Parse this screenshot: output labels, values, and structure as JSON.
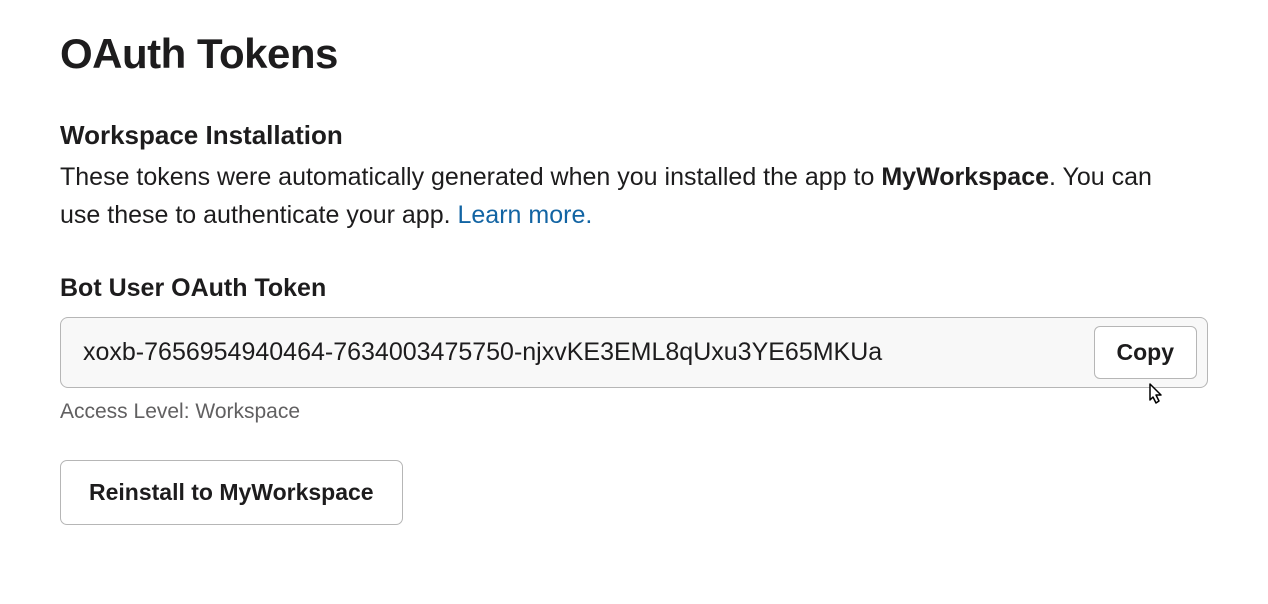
{
  "page": {
    "title": "OAuth Tokens"
  },
  "workspace_installation": {
    "heading": "Workspace Installation",
    "description_prefix": "These tokens were automatically generated when you installed the app to ",
    "workspace_name": "MyWorkspace",
    "description_suffix": ". You can use these to authenticate your app. ",
    "learn_more_label": "Learn more."
  },
  "token": {
    "label": "Bot User OAuth Token",
    "value": "xoxb-7656954940464-7634003475750-njxvKE3EML8qUxu3YE65MKUa",
    "copy_label": "Copy",
    "access_level": "Access Level: Workspace"
  },
  "actions": {
    "reinstall_label": "Reinstall to MyWorkspace"
  }
}
